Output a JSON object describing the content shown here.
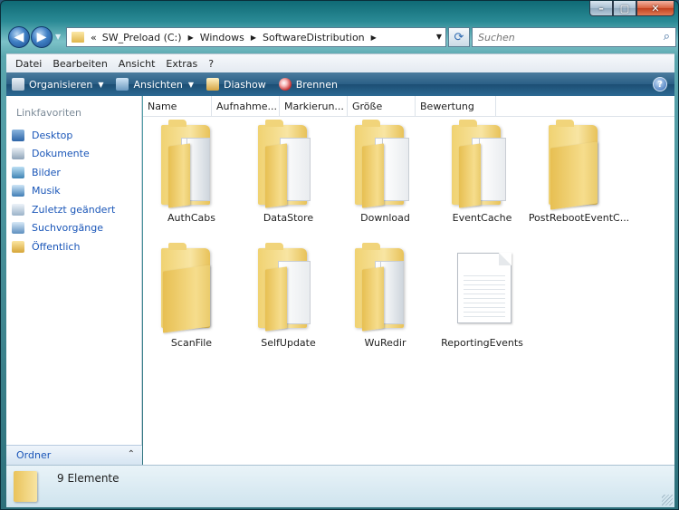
{
  "window": {
    "caption_buttons": [
      "minimize",
      "maximize",
      "close"
    ]
  },
  "address": {
    "prefix": "«",
    "crumbs": [
      "SW_Preload (C:)",
      "Windows",
      "SoftwareDistribution"
    ]
  },
  "search": {
    "placeholder": "Suchen"
  },
  "menu": [
    "Datei",
    "Bearbeiten",
    "Ansicht",
    "Extras",
    "?"
  ],
  "commands": {
    "organize": "Organisieren",
    "views": "Ansichten",
    "slideshow": "Diashow",
    "burn": "Brennen",
    "help": "?"
  },
  "nav": {
    "header": "Linkfavoriten",
    "links": [
      "Desktop",
      "Dokumente",
      "Bilder",
      "Musik",
      "Zuletzt geändert",
      "Suchvorgänge",
      "Öffentlich"
    ],
    "folders_label": "Ordner"
  },
  "columns": [
    "Name",
    "Aufnahme...",
    "Markierun...",
    "Größe",
    "Bewertung"
  ],
  "items": [
    {
      "name": "AuthCabs",
      "type": "folder-with-files"
    },
    {
      "name": "DataStore",
      "type": "folder-with-doc"
    },
    {
      "name": "Download",
      "type": "folder-with-files"
    },
    {
      "name": "EventCache",
      "type": "folder-with-doc"
    },
    {
      "name": "PostRebootEventC...",
      "type": "folder-empty"
    },
    {
      "name": "ScanFile",
      "type": "folder-empty"
    },
    {
      "name": "SelfUpdate",
      "type": "folder-with-doc"
    },
    {
      "name": "WuRedir",
      "type": "folder-with-files"
    },
    {
      "name": "ReportingEvents",
      "type": "file"
    }
  ],
  "status": {
    "count_text": "9 Elemente"
  }
}
